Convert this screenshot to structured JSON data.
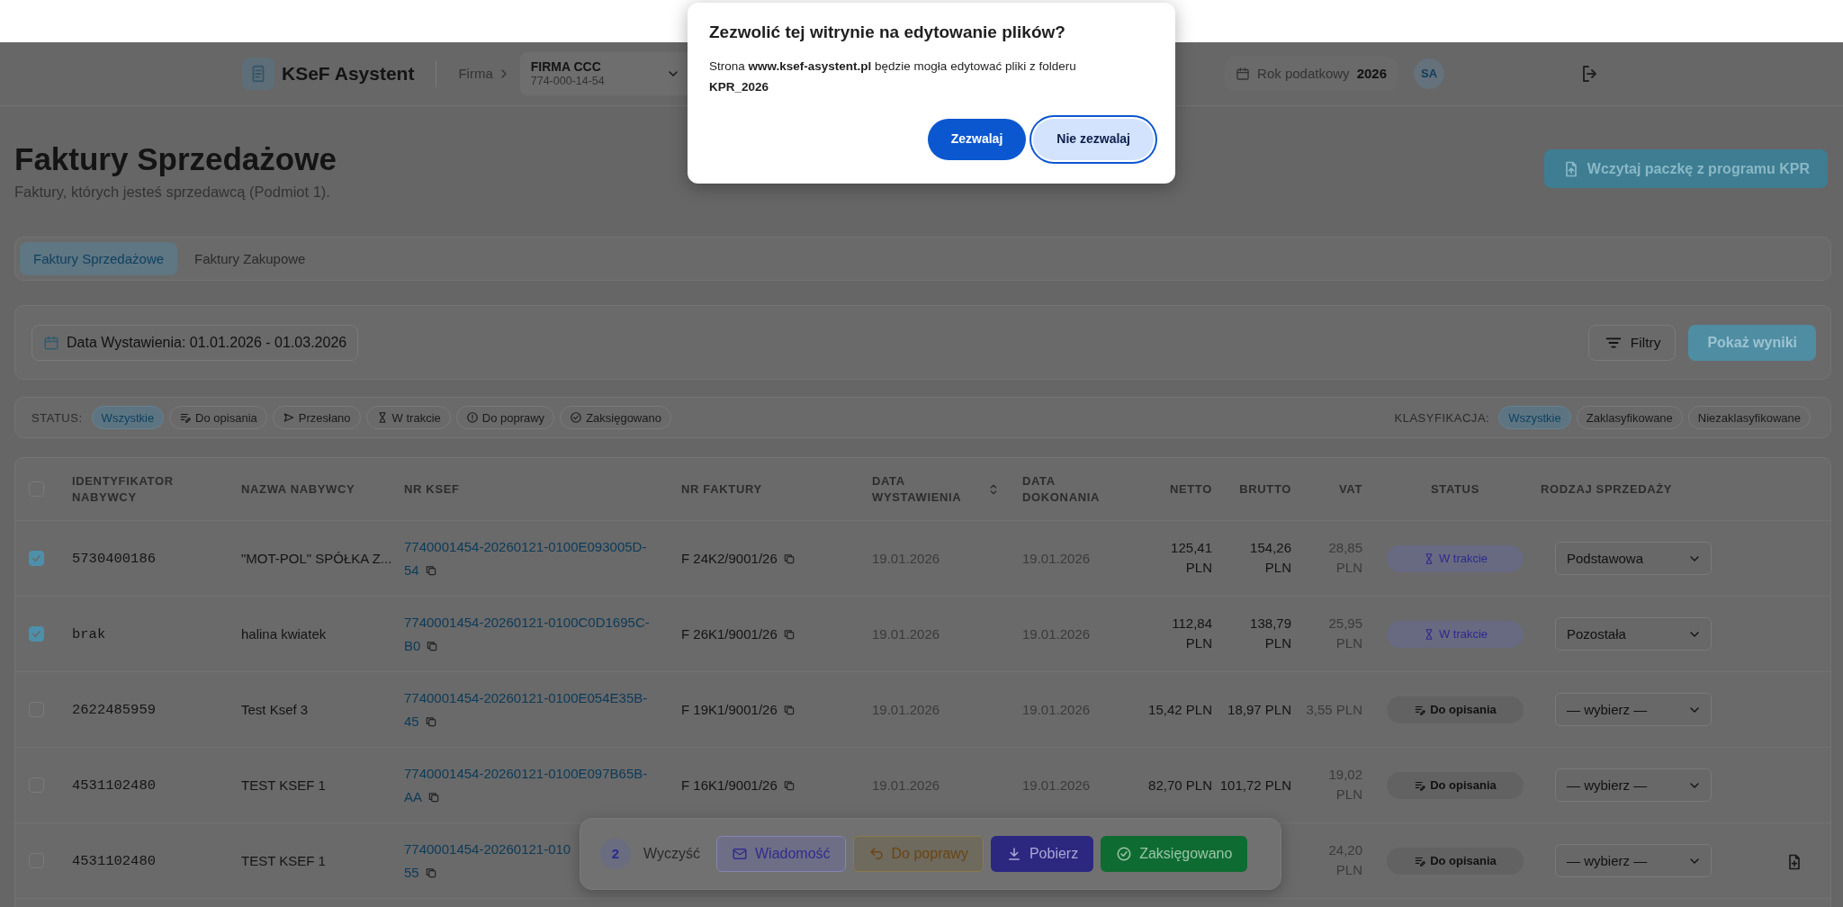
{
  "dialog": {
    "title": "Zezwolić tej witrynie na edytowanie plików?",
    "message": "Strona **www.ksef-asystent.pl** będzie mogła edytować pliki z folderu **KPR_2026**",
    "buttons": [
      {
        "label": "Zezwalaj",
        "kind": "primary",
        "focused": false
      },
      {
        "label": "Nie zezwalaj",
        "kind": "secondary",
        "focused": true
      }
    ]
  },
  "header": {
    "app_name": "KSeF Asystent",
    "company_label": "Firma",
    "company_name": "FIRMA CCC",
    "company_nip": "774-000-14-54",
    "tax_year_label": "Rok podatkowy",
    "tax_year": "2026",
    "avatar": "SA"
  },
  "page": {
    "title": "Faktury Sprzedażowe",
    "subtitle": "Faktury, których jesteś sprzedawcą (Podmiot 1).",
    "upload_button": "Wczytaj paczkę z programu KPR"
  },
  "tabs": [
    {
      "label": "Faktury Sprzedażowe",
      "selected": true
    },
    {
      "label": "Faktury Zakupowe",
      "selected": false
    }
  ],
  "filters": {
    "date_range": "Data Wystawienia: 01.01.2026 - 01.03.2026",
    "filter_button": "Filtry",
    "show_button": "Pokaż wyniki"
  },
  "status_filter": {
    "label": "STATUS:",
    "chips": [
      {
        "label": "Wszystkie",
        "kind": "all",
        "selected": true
      },
      {
        "label": "Do opisania",
        "kind": "to_describe",
        "selected": false
      },
      {
        "label": "Przesłano",
        "kind": "sent",
        "selected": false
      },
      {
        "label": "W trakcie",
        "kind": "in_progress",
        "selected": false
      },
      {
        "label": "Do poprawy",
        "kind": "to_fix",
        "selected": false
      },
      {
        "label": "Zaksięgowano",
        "kind": "booked",
        "selected": false
      }
    ]
  },
  "class_filter": {
    "label": "KLASYFIKACJA:",
    "chips": [
      {
        "label": "Wszystkie",
        "selected": true
      },
      {
        "label": "Zaklasyfikowane",
        "selected": false
      },
      {
        "label": "Niezaklasyfikowane",
        "selected": false
      }
    ]
  },
  "table": {
    "all_checked": false,
    "columns": [
      {
        "label": "IDENTYFIKATOR NABYWCY",
        "sortable": false
      },
      {
        "label": "NAZWA NABYWCY",
        "sortable": false
      },
      {
        "label": "NR KSEF",
        "sortable": false
      },
      {
        "label": "NR FAKTURY",
        "sortable": false
      },
      {
        "label": "DATA WYSTAWIENIA",
        "sortable": true
      },
      {
        "label": "DATA DOKONANIA",
        "sortable": false
      },
      {
        "label": "NETTO",
        "sortable": false
      },
      {
        "label": "BRUTTO",
        "sortable": false
      },
      {
        "label": "VAT",
        "sortable": false
      },
      {
        "label": "STATUS",
        "sortable": false
      },
      {
        "label": "RODZAJ SPRZEDAŻY",
        "sortable": false
      }
    ],
    "rows": [
      {
        "checked": true,
        "buyer_id": "5730400186",
        "buyer_name": "\"MOT-POL\" SPÓŁKA Z...",
        "ksef_lines": [
          "7740001454-20260121-0100E093005D-",
          "54"
        ],
        "invoice_no": "F 24K2/9001/26",
        "issue_date": "19.01.2026",
        "done_date": "19.01.2026",
        "netto": "125,41\nPLN",
        "brutto": "154,26\nPLN",
        "vat": "28,85\nPLN",
        "status": {
          "label": "W trakcie",
          "kind": "in_progress"
        },
        "sale_type": "Podstawowa",
        "has_document": false
      },
      {
        "checked": true,
        "buyer_id": "brak",
        "buyer_name": "halina kwiatek",
        "ksef_lines": [
          "7740001454-20260121-0100C0D1695C-",
          "B0"
        ],
        "invoice_no": "F 26K1/9001/26",
        "issue_date": "19.01.2026",
        "done_date": "19.01.2026",
        "netto": "112,84\nPLN",
        "brutto": "138,79\nPLN",
        "vat": "25,95\nPLN",
        "status": {
          "label": "W trakcie",
          "kind": "in_progress"
        },
        "sale_type": "Pozostała",
        "has_document": false
      },
      {
        "checked": false,
        "buyer_id": "2622485959",
        "buyer_name": "Test Ksef 3",
        "ksef_lines": [
          "7740001454-20260121-0100E054E35B-",
          "45"
        ],
        "invoice_no": "F 19K1/9001/26",
        "issue_date": "19.01.2026",
        "done_date": "19.01.2026",
        "netto": "15,42 PLN",
        "brutto": "18,97 PLN",
        "vat": "3,55 PLN",
        "status": {
          "label": "Do opisania",
          "kind": "to_describe"
        },
        "sale_type": "— wybierz —",
        "has_document": false
      },
      {
        "checked": false,
        "buyer_id": "4531102480",
        "buyer_name": "TEST KSEF 1",
        "ksef_lines": [
          "7740001454-20260121-0100E097B65B-",
          "AA"
        ],
        "invoice_no": "F 16K1/9001/26",
        "issue_date": "19.01.2026",
        "done_date": "19.01.2026",
        "netto": "82,70 PLN",
        "brutto": "101,72 PLN",
        "vat": "19,02\nPLN",
        "status": {
          "label": "Do opisania",
          "kind": "to_describe"
        },
        "sale_type": "— wybierz —",
        "has_document": false
      },
      {
        "checked": false,
        "buyer_id": "4531102480",
        "buyer_name": "TEST KSEF 1",
        "ksef_lines": [
          "7740001454-20260121-010",
          "55"
        ],
        "vat": "24,20\nPLN",
        "status": {
          "label": "Do opisania",
          "kind": "to_describe"
        },
        "sale_type": "— wybierz —",
        "has_document": true
      }
    ]
  },
  "bulk_bar": {
    "count": "2",
    "clear": "Wyczyść",
    "buttons": [
      {
        "label": "Wiadomość",
        "kind": "message"
      },
      {
        "label": "Do poprawy",
        "kind": "to_fix"
      },
      {
        "label": "Pobierz",
        "kind": "download"
      },
      {
        "label": "Zaksięgowano",
        "kind": "booked"
      }
    ]
  }
}
